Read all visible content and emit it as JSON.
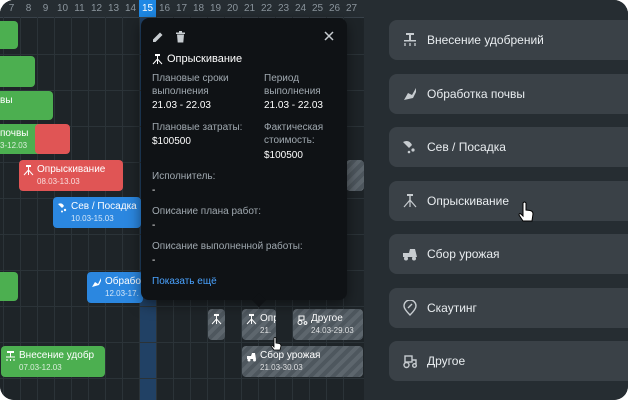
{
  "timeline": {
    "days": [
      "7",
      "8",
      "9",
      "10",
      "11",
      "12",
      "13",
      "14",
      "15",
      "16",
      "17",
      "18",
      "19",
      "20",
      "21",
      "22",
      "23",
      "24",
      "25",
      "26",
      "27"
    ],
    "today": "15"
  },
  "tasks": {
    "bar_a": {
      "title": "вы",
      "dates": ""
    },
    "bar_b": {
      "title": "почвы",
      "dates": "3-12.03"
    },
    "spray": {
      "title": "Опрыскивание",
      "dates": "08.03-13.03"
    },
    "sow": {
      "title": "Сев / Посадка",
      "dates": "10.03-15.03"
    },
    "process": {
      "title": "Обрабо",
      "dates": "12.03-17."
    },
    "fert": {
      "title": "Внесение удобр",
      "dates": "07.03-12.03"
    },
    "spray_gray": {
      "title": "Опр",
      "dates": "21."
    },
    "other": {
      "title": "Другое",
      "dates": "24.03-29.03"
    },
    "harvest": {
      "title": "Сбор урожая",
      "dates": "21.03-30.03"
    }
  },
  "popup": {
    "title": "Опрыскивание",
    "planned_dates_label": "Плановые сроки выполнения",
    "planned_dates_value": "21.03 - 22.03",
    "period_label": "Период выполнения",
    "period_value": "21.03 - 22.03",
    "planned_cost_label": "Плановые затраты:",
    "planned_cost_value": "$100500",
    "actual_cost_label": "Фактическая стоимость:",
    "actual_cost_value": "$100500",
    "executor_label": "Исполнитель:",
    "executor_value": "-",
    "plan_desc_label": "Описание плана работ:",
    "plan_desc_value": "-",
    "done_desc_label": "Описание выполненной работы:",
    "done_desc_value": "-",
    "show_more": "Показать ещё"
  },
  "sidebar": {
    "items": [
      {
        "label": "Внесение удобрений",
        "icon": "fertilizer-icon"
      },
      {
        "label": "Обработка почвы",
        "icon": "soil-icon"
      },
      {
        "label": "Сев / Посадка",
        "icon": "sowing-icon"
      },
      {
        "label": "Опрыскивание",
        "icon": "spray-icon"
      },
      {
        "label": "Сбор урожая",
        "icon": "harvest-icon"
      },
      {
        "label": "Скаутинг",
        "icon": "scouting-icon"
      },
      {
        "label": "Другое",
        "icon": "tractor-icon"
      }
    ]
  },
  "colors": {
    "green": "#4caf50",
    "red": "#e05555",
    "blue": "#2b87e0",
    "today": "#1e88e5",
    "link": "#4aa3ff"
  }
}
